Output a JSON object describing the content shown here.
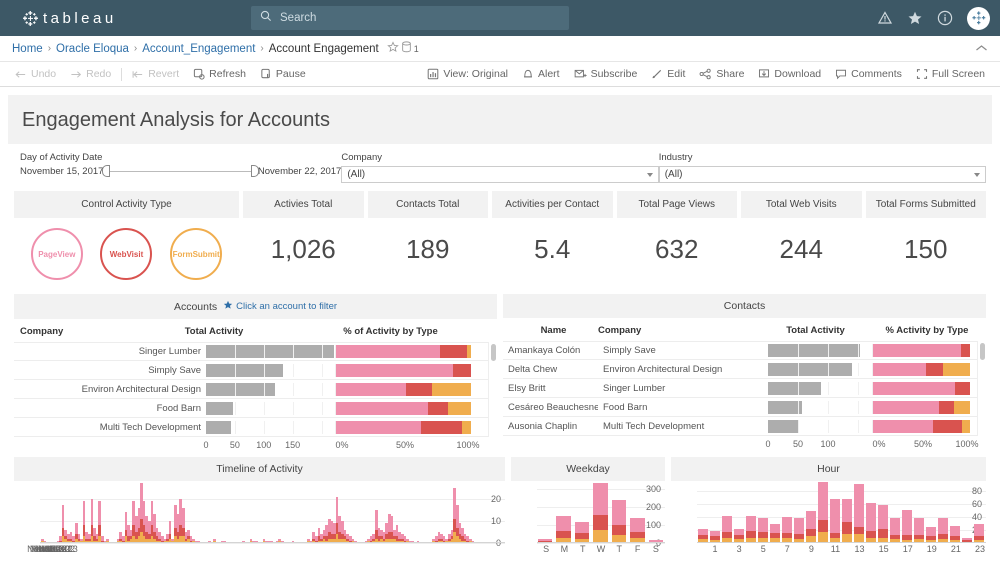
{
  "brand": {
    "name": "tableau",
    "bar_color": "#3d5866"
  },
  "search": {
    "placeholder": "Search",
    "icon": "search-icon"
  },
  "nav_icons": [
    {
      "name": "alerts-warning-icon"
    },
    {
      "name": "favorites-star-icon"
    },
    {
      "name": "info-icon"
    },
    {
      "name": "user-avatar"
    }
  ],
  "breadcrumb": {
    "items": [
      {
        "label": "Home",
        "link": true
      },
      {
        "label": "Oracle Eloqua",
        "link": true
      },
      {
        "label": "Account_Engagement",
        "link": true
      },
      {
        "label": "Account Engagement",
        "link": false
      }
    ],
    "separator": "›",
    "favorite_icon": "star-outline-icon",
    "datasource_icon": "database-icon",
    "datasource_count": "1",
    "collapse_icon": "chevron-up-icon"
  },
  "toolbar": {
    "left": [
      {
        "label": "Undo",
        "icon": "undo-arrow-icon",
        "disabled": true
      },
      {
        "label": "Redo",
        "icon": "redo-arrow-icon",
        "disabled": true
      },
      {
        "label": "Revert",
        "icon": "revert-icon",
        "disabled": true
      },
      {
        "label": "Refresh",
        "icon": "refresh-icon",
        "disabled": false
      },
      {
        "label": "Pause",
        "icon": "pause-icon",
        "disabled": false
      }
    ],
    "right": [
      {
        "label": "View: Original",
        "icon": "view-chart-icon"
      },
      {
        "label": "Alert",
        "icon": "alert-bell-icon"
      },
      {
        "label": "Subscribe",
        "icon": "subscribe-envelope-icon"
      },
      {
        "label": "Edit",
        "icon": "edit-pencil-icon"
      },
      {
        "label": "Share",
        "icon": "share-nodes-icon"
      },
      {
        "label": "Download",
        "icon": "download-icon"
      },
      {
        "label": "Comments",
        "icon": "comment-bubble-icon"
      },
      {
        "label": "Full Screen",
        "icon": "fullscreen-icon"
      }
    ]
  },
  "dashboard": {
    "title": "Engagement Analysis for Accounts",
    "filters": {
      "date": {
        "label": "Day of Activity Date",
        "start": "November 15, 2017",
        "end": "November 22, 2017"
      },
      "company": {
        "label": "Company",
        "value": "(All)"
      },
      "industry": {
        "label": "Industry",
        "value": "(All)"
      }
    },
    "control": {
      "header": "Control Activity Type",
      "buttons": [
        {
          "label": "PageView",
          "color": "#ef8fac"
        },
        {
          "label": "WebVisit",
          "color": "#d9534f"
        },
        {
          "label": "FormSubmit",
          "color": "#f0ad4e"
        }
      ]
    },
    "kpis": [
      {
        "label": "Activies Total",
        "value": "1,026"
      },
      {
        "label": "Contacts Total",
        "value": "189"
      },
      {
        "label": "Activities per Contact",
        "value": "5.4"
      },
      {
        "label": "Total Page Views",
        "value": "632"
      },
      {
        "label": "Total Web Visits",
        "value": "244"
      },
      {
        "label": "Total Forms Submitted",
        "value": "150"
      }
    ],
    "accounts": {
      "header": "Accounts",
      "hint": "Click an account to filter",
      "hint_icon": "star-filled-icon",
      "columns": [
        "Company",
        "Total Activity",
        "% of Activity by Type"
      ],
      "rows": [
        {
          "company": "Singer Lumber",
          "total": 172,
          "pct": [
            77,
            20,
            3
          ]
        },
        {
          "company": "Simply Save",
          "total": 104,
          "pct": [
            87,
            13,
            0
          ]
        },
        {
          "company": "Environ Architectural Design",
          "total": 93,
          "pct": [
            52,
            19,
            29
          ]
        },
        {
          "company": "Food Barn",
          "total": 37,
          "pct": [
            68,
            15,
            17
          ]
        },
        {
          "company": "Multi Tech Development",
          "total": 34,
          "pct": [
            63,
            30,
            7
          ]
        }
      ],
      "x_total_ticks": [
        "0",
        "50",
        "100",
        "150"
      ],
      "x_pct_ticks": [
        "0%",
        "50%",
        "100%"
      ],
      "total_max": 175
    },
    "contacts": {
      "header": "Contacts",
      "columns": [
        "Name",
        "Company",
        "Total Activity",
        "% Activity by Type"
      ],
      "rows": [
        {
          "name": "Amankaya Colón",
          "company": "Simply Save",
          "total": 101,
          "pct": [
            91,
            9,
            0
          ]
        },
        {
          "name": "Delta Chew",
          "company": "Environ Architectural Design",
          "total": 92,
          "pct": [
            55,
            17,
            28
          ]
        },
        {
          "name": "Elsy Britt",
          "company": "Singer Lumber",
          "total": 58,
          "pct": [
            85,
            15,
            0
          ]
        },
        {
          "name": "Cesáreo Beauchesne",
          "company": "Food Barn",
          "total": 37,
          "pct": [
            68,
            16,
            16
          ]
        },
        {
          "name": "Ausonia Chaplin",
          "company": "Multi Tech Development",
          "total": 33,
          "pct": [
            62,
            30,
            8
          ]
        }
      ],
      "x_total_ticks": [
        "0",
        "50",
        "100"
      ],
      "x_pct_ticks": [
        "0%",
        "50%",
        "100%"
      ],
      "total_max": 115
    }
  },
  "chart_data": [
    {
      "type": "bar",
      "id": "timeline-of-activity",
      "title": "Timeline of Activity",
      "xlabel": "",
      "ylabel": "",
      "ylim": [
        0,
        28
      ],
      "yticks": [
        0,
        10,
        20
      ],
      "grid": true,
      "stacked": true,
      "legend": [
        "PageView",
        "WebVisit",
        "FormSubmit"
      ],
      "colors": [
        "#ef8fac",
        "#d9534f",
        "#f0ad4e"
      ],
      "xtick_labels": [
        "Nov 15",
        "Nov 16",
        "Nov 17",
        "Nov 18",
        "Nov 19",
        "Nov 20",
        "Nov 21",
        "Nov 22",
        "Nov 23"
      ],
      "note": "Hourly stacked bars across 8 days; sparse overnight, dense during business hours",
      "values": [
        2,
        1,
        0,
        0,
        0,
        0,
        1,
        3,
        17,
        6,
        4,
        5,
        3,
        9,
        4,
        2,
        19,
        5,
        4,
        20,
        7,
        4,
        19,
        3,
        1,
        2,
        0,
        0,
        0,
        2,
        5,
        3,
        14,
        8,
        6,
        19,
        12,
        16,
        27,
        19,
        12,
        10,
        19,
        13,
        7,
        5,
        3,
        2,
        4,
        10,
        2,
        17,
        13,
        20,
        16,
        5,
        6,
        3,
        2,
        1,
        1,
        0,
        0,
        0,
        1,
        0,
        2,
        0,
        0,
        1,
        1,
        0,
        0,
        0,
        0,
        0,
        0,
        1,
        0,
        0,
        2,
        1,
        1,
        0,
        0,
        2,
        1,
        1,
        1,
        0,
        1,
        2,
        1,
        0,
        0,
        0,
        1,
        0,
        0,
        0,
        0,
        0,
        2,
        1,
        5,
        3,
        7,
        4,
        6,
        8,
        11,
        10,
        9,
        21,
        12,
        10,
        6,
        4,
        3,
        2,
        1,
        0,
        0,
        0,
        1,
        2,
        3,
        4,
        15,
        7,
        6,
        5,
        9,
        13,
        12,
        6,
        8,
        5,
        4,
        3,
        2,
        1,
        1,
        0,
        1,
        0,
        0,
        0,
        0,
        0,
        2,
        3,
        5,
        4,
        3,
        2,
        4,
        6,
        25,
        17,
        9,
        7,
        4,
        3,
        2,
        1,
        0,
        0
      ]
    },
    {
      "type": "bar",
      "id": "weekday",
      "title": "Weekday",
      "xlabel": "",
      "ylabel": "",
      "ylim": [
        0,
        345
      ],
      "yticks": [
        0,
        100,
        200,
        300
      ],
      "grid": true,
      "stacked": true,
      "categories": [
        "S",
        "M",
        "T",
        "W",
        "T",
        "F",
        "S"
      ],
      "series": [
        {
          "name": "PageView",
          "color": "#ef8fac",
          "values": [
            10,
            80,
            62,
            180,
            140,
            78,
            8
          ]
        },
        {
          "name": "WebVisit",
          "color": "#d9534f",
          "values": [
            6,
            40,
            32,
            80,
            58,
            34,
            4
          ]
        },
        {
          "name": "FormSubmit",
          "color": "#f0ad4e",
          "values": [
            4,
            28,
            21,
            75,
            42,
            28,
            3
          ]
        }
      ],
      "totals": [
        20,
        148,
        115,
        335,
        240,
        140,
        15
      ]
    },
    {
      "type": "bar",
      "id": "hour",
      "title": "Hour",
      "xlabel": "",
      "ylabel": "",
      "ylim": [
        0,
        95
      ],
      "yticks": [
        20,
        40,
        60,
        80
      ],
      "grid": true,
      "stacked": true,
      "categories": [
        "0",
        "1",
        "2",
        "3",
        "4",
        "5",
        "6",
        "7",
        "8",
        "9",
        "10",
        "11",
        "12",
        "13",
        "14",
        "15",
        "16",
        "17",
        "18",
        "19",
        "20",
        "21",
        "22",
        "23"
      ],
      "xtick_labels": [
        "1",
        "3",
        "5",
        "7",
        "9",
        "11",
        "13",
        "15",
        "17",
        "19",
        "21",
        "23"
      ],
      "series": [
        {
          "name": "PageView",
          "color": "#ef8fac",
          "values": [
            10,
            8,
            24,
            10,
            24,
            22,
            14,
            24,
            24,
            27,
            58,
            52,
            36,
            66,
            44,
            36,
            26,
            38,
            26,
            14,
            24,
            16,
            4,
            18
          ]
        },
        {
          "name": "WebVisit",
          "color": "#d9534f",
          "values": [
            6,
            6,
            10,
            6,
            10,
            9,
            8,
            9,
            8,
            12,
            18,
            9,
            18,
            10,
            10,
            14,
            6,
            8,
            6,
            6,
            8,
            6,
            2,
            6
          ]
        },
        {
          "name": "FormSubmit",
          "color": "#f0ad4e",
          "values": [
            6,
            5,
            7,
            6,
            8,
            8,
            7,
            7,
            6,
            10,
            17,
            7,
            14,
            14,
            8,
            8,
            6,
            5,
            6,
            5,
            6,
            4,
            2,
            5
          ]
        }
      ],
      "totals": [
        22,
        19,
        41,
        22,
        42,
        39,
        29,
        40,
        38,
        49,
        93,
        68,
        68,
        90,
        62,
        58,
        38,
        51,
        38,
        25,
        38,
        26,
        8,
        29
      ]
    }
  ]
}
